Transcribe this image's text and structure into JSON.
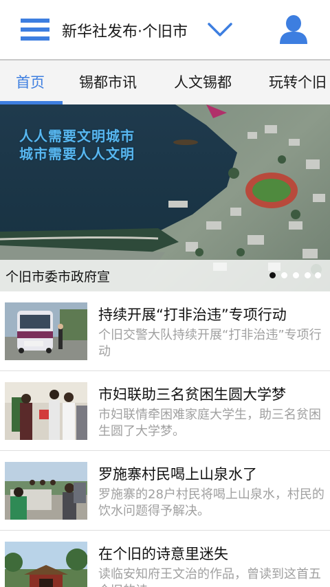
{
  "header": {
    "title": "新华社发布·个旧市",
    "menu_icon": "hamburger-menu-icon",
    "dropdown_icon": "chevron-down-icon",
    "user_icon": "user-profile-icon",
    "accent_color": "#3d7ee0"
  },
  "tabs": [
    {
      "label": "首页",
      "active": true
    },
    {
      "label": "锡都市讯",
      "active": false
    },
    {
      "label": "人文锡都",
      "active": false
    },
    {
      "label": "玩转个旧",
      "active": false
    }
  ],
  "banner": {
    "slogan_line1": "人人需要文明城市",
    "slogan_line2": "城市需要人人文明",
    "caption": "个旧市委市政府宣",
    "slide_count": 5,
    "active_slide": 1
  },
  "news": [
    {
      "title": "持续开展“打非治违”专项行动",
      "summary": "个旧交警大队持续开展“打非治违”专项行动",
      "thumbnail": "bus-inspection-photo"
    },
    {
      "title": "市妇联助三名贫困生圆大学梦",
      "summary": "市妇联情牵困难家庭大学生，助三名贫困生圆了大学梦。",
      "thumbnail": "women-federation-photo"
    },
    {
      "title": "罗施寨村民喝上山泉水了",
      "summary": "罗施寨的28户村民将喝上山泉水，村民的饮水问题得予解决。",
      "thumbnail": "villagers-water-photo"
    },
    {
      "title": "在个旧的诗意里迷失",
      "summary": "读临安知府王文治的作品，曾读到这首五个旧的诗",
      "thumbnail": "temple-scenery-photo"
    }
  ]
}
